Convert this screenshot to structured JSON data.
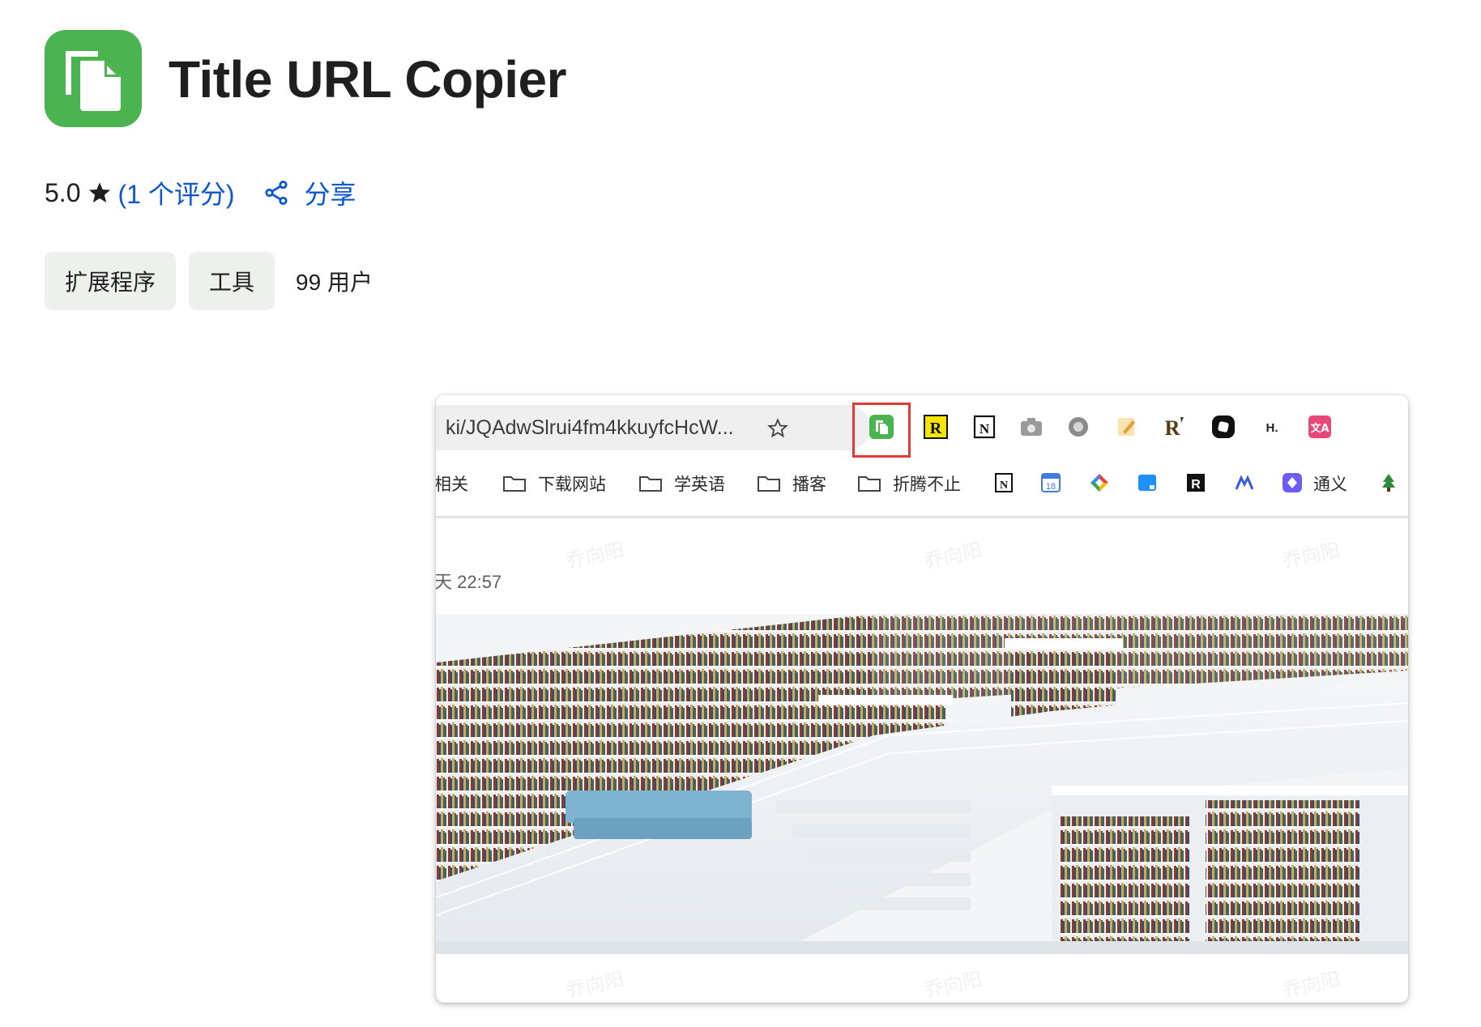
{
  "app": {
    "title": "Title URL Copier"
  },
  "rating": {
    "value": "5.0",
    "count_label": "(1 个评分)",
    "share_label": "分享"
  },
  "chips": [
    {
      "label": "扩展程序"
    },
    {
      "label": "工具"
    }
  ],
  "users_label": "99 用户",
  "screenshot": {
    "url_text": "ki/JQAdwSlrui4fm4kkuyfcHcW...",
    "bookmarks": [
      {
        "label": "相关"
      },
      {
        "label": "下载网站"
      },
      {
        "label": "学英语"
      },
      {
        "label": "播客"
      },
      {
        "label": "折腾不止"
      },
      {
        "label": "通义"
      }
    ],
    "calendar_badge": "18",
    "timestamp": "天 22:57",
    "watermark": "乔向阳"
  },
  "colors": {
    "icon_green": "#4cb351",
    "link_blue": "#0b57d0",
    "highlight_red": "#e53935",
    "chip_bg": "#eef0ee"
  }
}
